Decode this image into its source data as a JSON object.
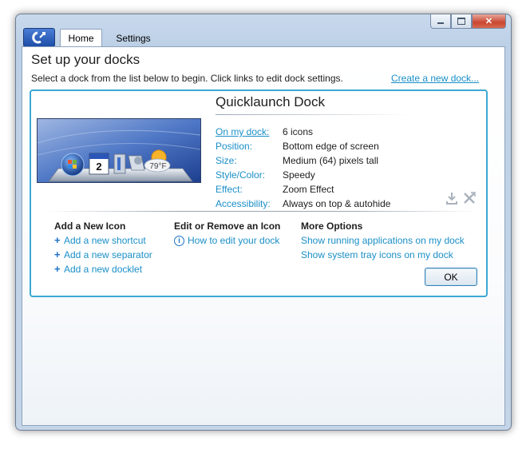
{
  "window": {
    "min_icon": "minimize-icon",
    "max_icon": "maximize-icon",
    "close_icon": "close-icon",
    "app_icon": "objectdock-icon"
  },
  "tabs": [
    {
      "label": "Home",
      "active": true
    },
    {
      "label": "Settings",
      "active": false
    }
  ],
  "page": {
    "title": "Set up your docks",
    "subtitle": "Select a dock from the list below to begin. Click links to edit dock settings.",
    "create_link": "Create a new dock..."
  },
  "dock": {
    "name": "Quicklaunch Dock",
    "properties": [
      {
        "label": "On my dock:",
        "value": "6 icons",
        "link": true
      },
      {
        "label": "Position:",
        "value": "Bottom edge of screen",
        "link": false
      },
      {
        "label": "Size:",
        "value": "Medium (64) pixels tall",
        "link": false
      },
      {
        "label": "Style/Color:",
        "value": "Speedy",
        "link": false
      },
      {
        "label": "Effect:",
        "value": "Zoom Effect",
        "link": false
      },
      {
        "label": "Accessibility:",
        "value": "Always on top & autohide",
        "link": false
      }
    ],
    "preview_icons": [
      "start-orb-icon",
      "calendar-icon",
      "files-icon",
      "satellite-icon",
      "weather-icon"
    ],
    "calendar_day": "2",
    "weather_temp": "79°F",
    "tool_icons": [
      "download-icon",
      "delete-icon"
    ]
  },
  "options": {
    "add_icon": {
      "heading": "Add a New Icon",
      "items": [
        "Add a new shortcut",
        "Add a new separator",
        "Add a new docklet"
      ]
    },
    "edit_icon": {
      "heading": "Edit or Remove an Icon",
      "items": [
        "How to edit your dock"
      ]
    },
    "more": {
      "heading": "More Options",
      "items": [
        "Show running applications on my dock",
        "Show system tray icons on my dock"
      ]
    }
  },
  "ok_label": "OK",
  "colors": {
    "accent": "#3aa8d4",
    "link": "#1a8fc7",
    "close": "#c9462f"
  }
}
